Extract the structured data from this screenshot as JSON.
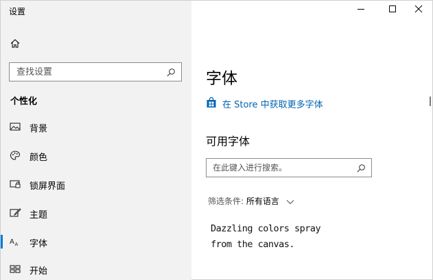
{
  "window": {
    "title": "设置",
    "controls": [
      "minimize",
      "maximize",
      "close"
    ]
  },
  "sidebar": {
    "home_icon": "home-icon",
    "search": {
      "placeholder": "查找设置",
      "value": ""
    },
    "section_heading": "个性化",
    "items": [
      {
        "label": "背景",
        "icon": "picture-icon"
      },
      {
        "label": "颜色",
        "icon": "palette-icon"
      },
      {
        "label": "锁屏界面",
        "icon": "lock-screen-icon"
      },
      {
        "label": "主题",
        "icon": "brush-icon"
      },
      {
        "label": "字体",
        "icon": "font-icon",
        "active": true
      },
      {
        "label": "开始",
        "icon": "start-grid-icon"
      }
    ]
  },
  "main": {
    "title": "字体",
    "store_link": "在 Store 中获取更多字体",
    "available_heading": "可用字体",
    "font_search": {
      "placeholder": "在此键入进行搜索。",
      "value": ""
    },
    "filter": {
      "label": "筛选条件:",
      "value": "所有语言"
    },
    "preview_lines": [
      "Dazzling colors spray",
      "from the canvas."
    ]
  },
  "colors": {
    "accent": "#0078d7",
    "link": "#0063b1",
    "sidebar_bg": "#f2f2f2"
  }
}
